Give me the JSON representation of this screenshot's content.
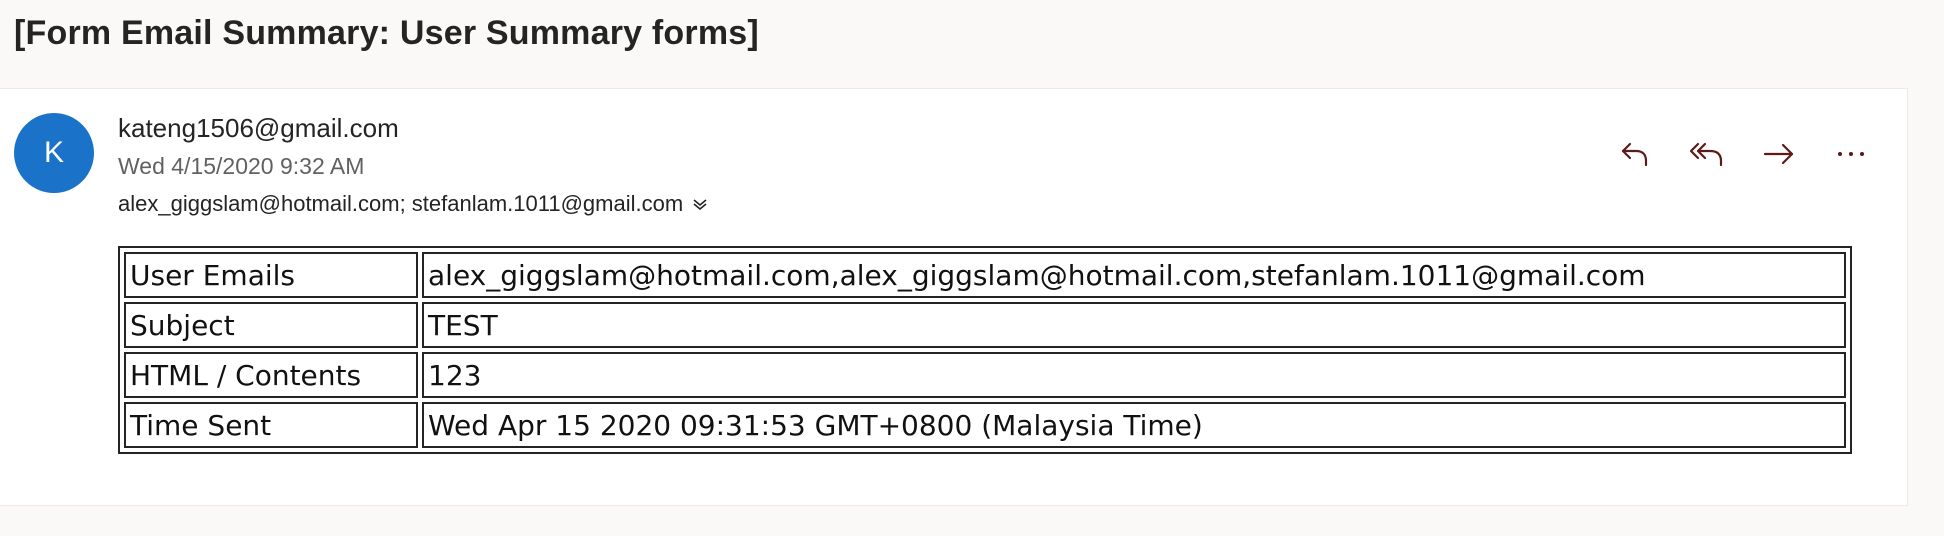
{
  "subject": "[Form Email Summary: User Summary forms]",
  "message": {
    "avatar_initial": "K",
    "sender": "kateng1506@gmail.com",
    "date": "Wed 4/15/2020 9:32 AM",
    "recipients": "alex_giggslam@hotmail.com; stefanlam.1011@gmail.com",
    "actions": {
      "reply": "reply-icon",
      "reply_all": "reply-all-icon",
      "forward": "forward-icon",
      "more": "more-icon"
    },
    "icon_color": "#5c1a1a",
    "avatar_color": "#1a73c9"
  },
  "summary_table": {
    "rows": [
      {
        "label": "User Emails",
        "value": "alex_giggslam@hotmail.com,alex_giggslam@hotmail.com,stefanlam.1011@gmail.com"
      },
      {
        "label": "Subject",
        "value": "TEST"
      },
      {
        "label": "HTML / Contents",
        "value": "123"
      },
      {
        "label": "Time Sent",
        "value": "Wed Apr 15 2020 09:31:53 GMT+0800 (Malaysia Time)"
      }
    ]
  }
}
